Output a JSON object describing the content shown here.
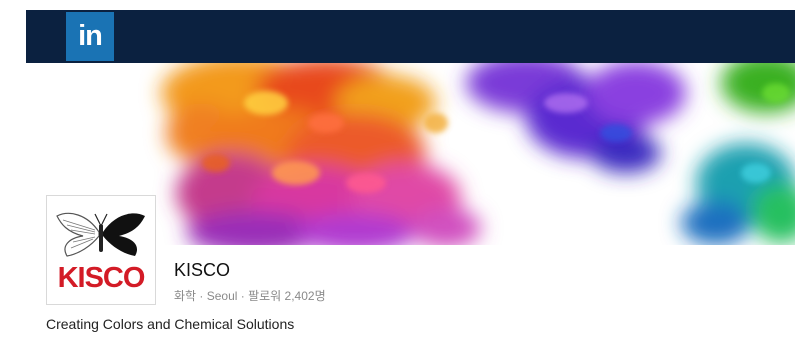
{
  "header": {
    "logo_text": "in",
    "bar_color": "#0b2140",
    "logo_color": "#1a73b4"
  },
  "banner": {
    "icon": "ink-cloud-banner-image"
  },
  "company": {
    "logo_text": "KISCO",
    "logo_color": "#d31b26",
    "name": "KISCO",
    "meta": "화학 · Seoul · 팔로워 2,402명",
    "tagline": "Creating Colors and Chemical Solutions"
  }
}
